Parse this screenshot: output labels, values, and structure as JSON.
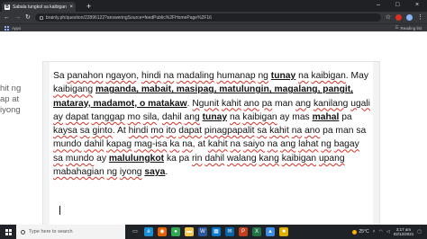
{
  "browser": {
    "tab_title": "Sabala tungkol sa kaibigan:Ganoo",
    "tab_close": "×",
    "new_tab": "+",
    "url": "brainly.ph/question/22896122?answeringSource=feedPublic%2FHomePage%2F16",
    "bookmarks_label": "Apps",
    "reading_list": "Reading list",
    "window_controls": {
      "minimize": "–",
      "maximize": "□",
      "close": "×"
    }
  },
  "background_text": {
    "lines": [
      "hit ng",
      "ap at",
      "iyong"
    ]
  },
  "document": {
    "text": [
      {
        "t": "Sa ",
        "s": ""
      },
      {
        "t": "panahon",
        "s": "w"
      },
      {
        "t": " ",
        "s": ""
      },
      {
        "t": "ngayon",
        "s": "w"
      },
      {
        "t": ", ",
        "s": ""
      },
      {
        "t": "hindi",
        "s": "w"
      },
      {
        "t": " ",
        "s": ""
      },
      {
        "t": "na",
        "s": "w"
      },
      {
        "t": " ",
        "s": ""
      },
      {
        "t": "madaling",
        "s": "w"
      },
      {
        "t": " ",
        "s": ""
      },
      {
        "t": "humanap",
        "s": "w"
      },
      {
        "t": " ",
        "s": ""
      },
      {
        "t": "ng",
        "s": "w"
      },
      {
        "t": " ",
        "s": ""
      },
      {
        "t": "tunay",
        "s": "b"
      },
      {
        "t": " ",
        "s": ""
      },
      {
        "t": "na",
        "s": "w"
      },
      {
        "t": " ",
        "s": ""
      },
      {
        "t": "kaibigan",
        "s": "w"
      },
      {
        "t": ". May ",
        "s": ""
      },
      {
        "t": "kaibigang",
        "s": "w"
      },
      {
        "t": " ",
        "s": ""
      },
      {
        "t": "maganda, mabait, masipag, matulungin, magalang, pangit, mataray, madamot, o matakaw",
        "s": "b"
      },
      {
        "t": ". ",
        "s": ""
      },
      {
        "t": "Ngunit",
        "s": "w"
      },
      {
        "t": " ",
        "s": ""
      },
      {
        "t": "kahit",
        "s": "w"
      },
      {
        "t": " ",
        "s": ""
      },
      {
        "t": "ano",
        "s": "w"
      },
      {
        "t": " ",
        "s": ""
      },
      {
        "t": "pa",
        "s": "w"
      },
      {
        "t": " man ",
        "s": ""
      },
      {
        "t": "ang",
        "s": "w"
      },
      {
        "t": " ",
        "s": ""
      },
      {
        "t": "kanilang",
        "s": "w"
      },
      {
        "t": " ",
        "s": ""
      },
      {
        "t": "ugali",
        "s": "w"
      },
      {
        "t": " ",
        "s": ""
      },
      {
        "t": "ay",
        "s": "w"
      },
      {
        "t": " ",
        "s": ""
      },
      {
        "t": "dapat",
        "s": "w"
      },
      {
        "t": " ",
        "s": ""
      },
      {
        "t": "tanggap",
        "s": "w"
      },
      {
        "t": " ",
        "s": ""
      },
      {
        "t": "mo",
        "s": "w"
      },
      {
        "t": " ",
        "s": ""
      },
      {
        "t": "sila",
        "s": "w"
      },
      {
        "t": ", ",
        "s": ""
      },
      {
        "t": "dahil",
        "s": "w"
      },
      {
        "t": " ",
        "s": ""
      },
      {
        "t": "ang",
        "s": "w"
      },
      {
        "t": " ",
        "s": ""
      },
      {
        "t": "tunay",
        "s": "b"
      },
      {
        "t": " ",
        "s": ""
      },
      {
        "t": "na",
        "s": "w"
      },
      {
        "t": " ",
        "s": ""
      },
      {
        "t": "kaibigan",
        "s": "w"
      },
      {
        "t": " ay mas ",
        "s": ""
      },
      {
        "t": "mahal",
        "s": "b"
      },
      {
        "t": " pa ",
        "s": ""
      },
      {
        "t": "kaysa",
        "s": "w"
      },
      {
        "t": " ",
        "s": ""
      },
      {
        "t": "sa",
        "s": "w"
      },
      {
        "t": " ",
        "s": ""
      },
      {
        "t": "ginto",
        "s": "w"
      },
      {
        "t": ". At ",
        "s": ""
      },
      {
        "t": "hindi",
        "s": "w"
      },
      {
        "t": " ",
        "s": ""
      },
      {
        "t": "mo",
        "s": "w"
      },
      {
        "t": " ",
        "s": ""
      },
      {
        "t": "ito",
        "s": "w"
      },
      {
        "t": " ",
        "s": ""
      },
      {
        "t": "dapat",
        "s": "w"
      },
      {
        "t": " ",
        "s": ""
      },
      {
        "t": "pinagpapalit",
        "s": "w"
      },
      {
        "t": " ",
        "s": ""
      },
      {
        "t": "sa",
        "s": "w"
      },
      {
        "t": " ",
        "s": ""
      },
      {
        "t": "kahit",
        "s": "w"
      },
      {
        "t": " ",
        "s": ""
      },
      {
        "t": "na",
        "s": "w"
      },
      {
        "t": " ",
        "s": ""
      },
      {
        "t": "ano",
        "s": "w"
      },
      {
        "t": " pa man sa ",
        "s": ""
      },
      {
        "t": "mundo",
        "s": "w"
      },
      {
        "t": " ",
        "s": ""
      },
      {
        "t": "dahil",
        "s": "w"
      },
      {
        "t": " ",
        "s": ""
      },
      {
        "t": "kapag",
        "s": "w"
      },
      {
        "t": " ",
        "s": ""
      },
      {
        "t": "mag-isa",
        "s": "w"
      },
      {
        "t": " ",
        "s": ""
      },
      {
        "t": "ka",
        "s": "w"
      },
      {
        "t": " ",
        "s": ""
      },
      {
        "t": "na",
        "s": "w"
      },
      {
        "t": ", at ",
        "s": ""
      },
      {
        "t": "kahit",
        "s": "w"
      },
      {
        "t": " ",
        "s": ""
      },
      {
        "t": "na",
        "s": "w"
      },
      {
        "t": " ",
        "s": ""
      },
      {
        "t": "saiyo",
        "s": "w"
      },
      {
        "t": " ",
        "s": ""
      },
      {
        "t": "na",
        "s": "w"
      },
      {
        "t": " ",
        "s": ""
      },
      {
        "t": "ang",
        "s": "w"
      },
      {
        "t": " ",
        "s": ""
      },
      {
        "t": "lahat",
        "s": "w"
      },
      {
        "t": " ",
        "s": ""
      },
      {
        "t": "ng",
        "s": "w"
      },
      {
        "t": " ",
        "s": ""
      },
      {
        "t": "bagay",
        "s": "w"
      },
      {
        "t": " ",
        "s": ""
      },
      {
        "t": "sa",
        "s": "w"
      },
      {
        "t": " ",
        "s": ""
      },
      {
        "t": "mundo",
        "s": "w"
      },
      {
        "t": " ay ",
        "s": ""
      },
      {
        "t": "malulungkot",
        "s": "b"
      },
      {
        "t": " ka pa ",
        "s": ""
      },
      {
        "t": "rin",
        "s": "w"
      },
      {
        "t": " ",
        "s": ""
      },
      {
        "t": "dahil",
        "s": "w"
      },
      {
        "t": " ",
        "s": ""
      },
      {
        "t": "walang",
        "s": "w"
      },
      {
        "t": " ",
        "s": ""
      },
      {
        "t": "kang",
        "s": "w"
      },
      {
        "t": " ",
        "s": ""
      },
      {
        "t": "kaibigan",
        "s": "w"
      },
      {
        "t": " ",
        "s": ""
      },
      {
        "t": "upang",
        "s": "w"
      },
      {
        "t": " ",
        "s": ""
      },
      {
        "t": "mabahagian",
        "s": "w"
      },
      {
        "t": " ",
        "s": ""
      },
      {
        "t": "ng",
        "s": "w"
      },
      {
        "t": " ",
        "s": ""
      },
      {
        "t": "iyong",
        "s": "w"
      },
      {
        "t": " ",
        "s": ""
      },
      {
        "t": "saya",
        "s": "b"
      },
      {
        "t": ".",
        "s": ""
      }
    ]
  },
  "taskbar": {
    "search_placeholder": "Type here to search",
    "apps": [
      {
        "name": "task-view-icon",
        "glyph": "▭",
        "color": "#1f2327"
      },
      {
        "name": "edge-icon",
        "glyph": "e",
        "color": "#1a8fd8"
      },
      {
        "name": "firefox-icon",
        "glyph": "◉",
        "color": "#e66000"
      },
      {
        "name": "chrome-icon",
        "glyph": "●",
        "color": "#34a853"
      },
      {
        "name": "explorer-icon",
        "glyph": "▬",
        "color": "#f2c94c"
      },
      {
        "name": "word-icon",
        "glyph": "W",
        "color": "#2b579a"
      },
      {
        "name": "store-icon",
        "glyph": "▦",
        "color": "#0078d4"
      },
      {
        "name": "mail-icon",
        "glyph": "✉",
        "color": "#0a64a4"
      },
      {
        "name": "powerpoint-icon",
        "glyph": "P",
        "color": "#c43e1c"
      },
      {
        "name": "excel-icon",
        "glyph": "X",
        "color": "#217346"
      },
      {
        "name": "photos-icon",
        "glyph": "▲",
        "color": "#3a8ee6"
      },
      {
        "name": "app-yellow-icon",
        "glyph": "■",
        "color": "#e0b000"
      }
    ],
    "weather": "25°C",
    "time": "3:17 am",
    "date": "02/12/2021"
  }
}
